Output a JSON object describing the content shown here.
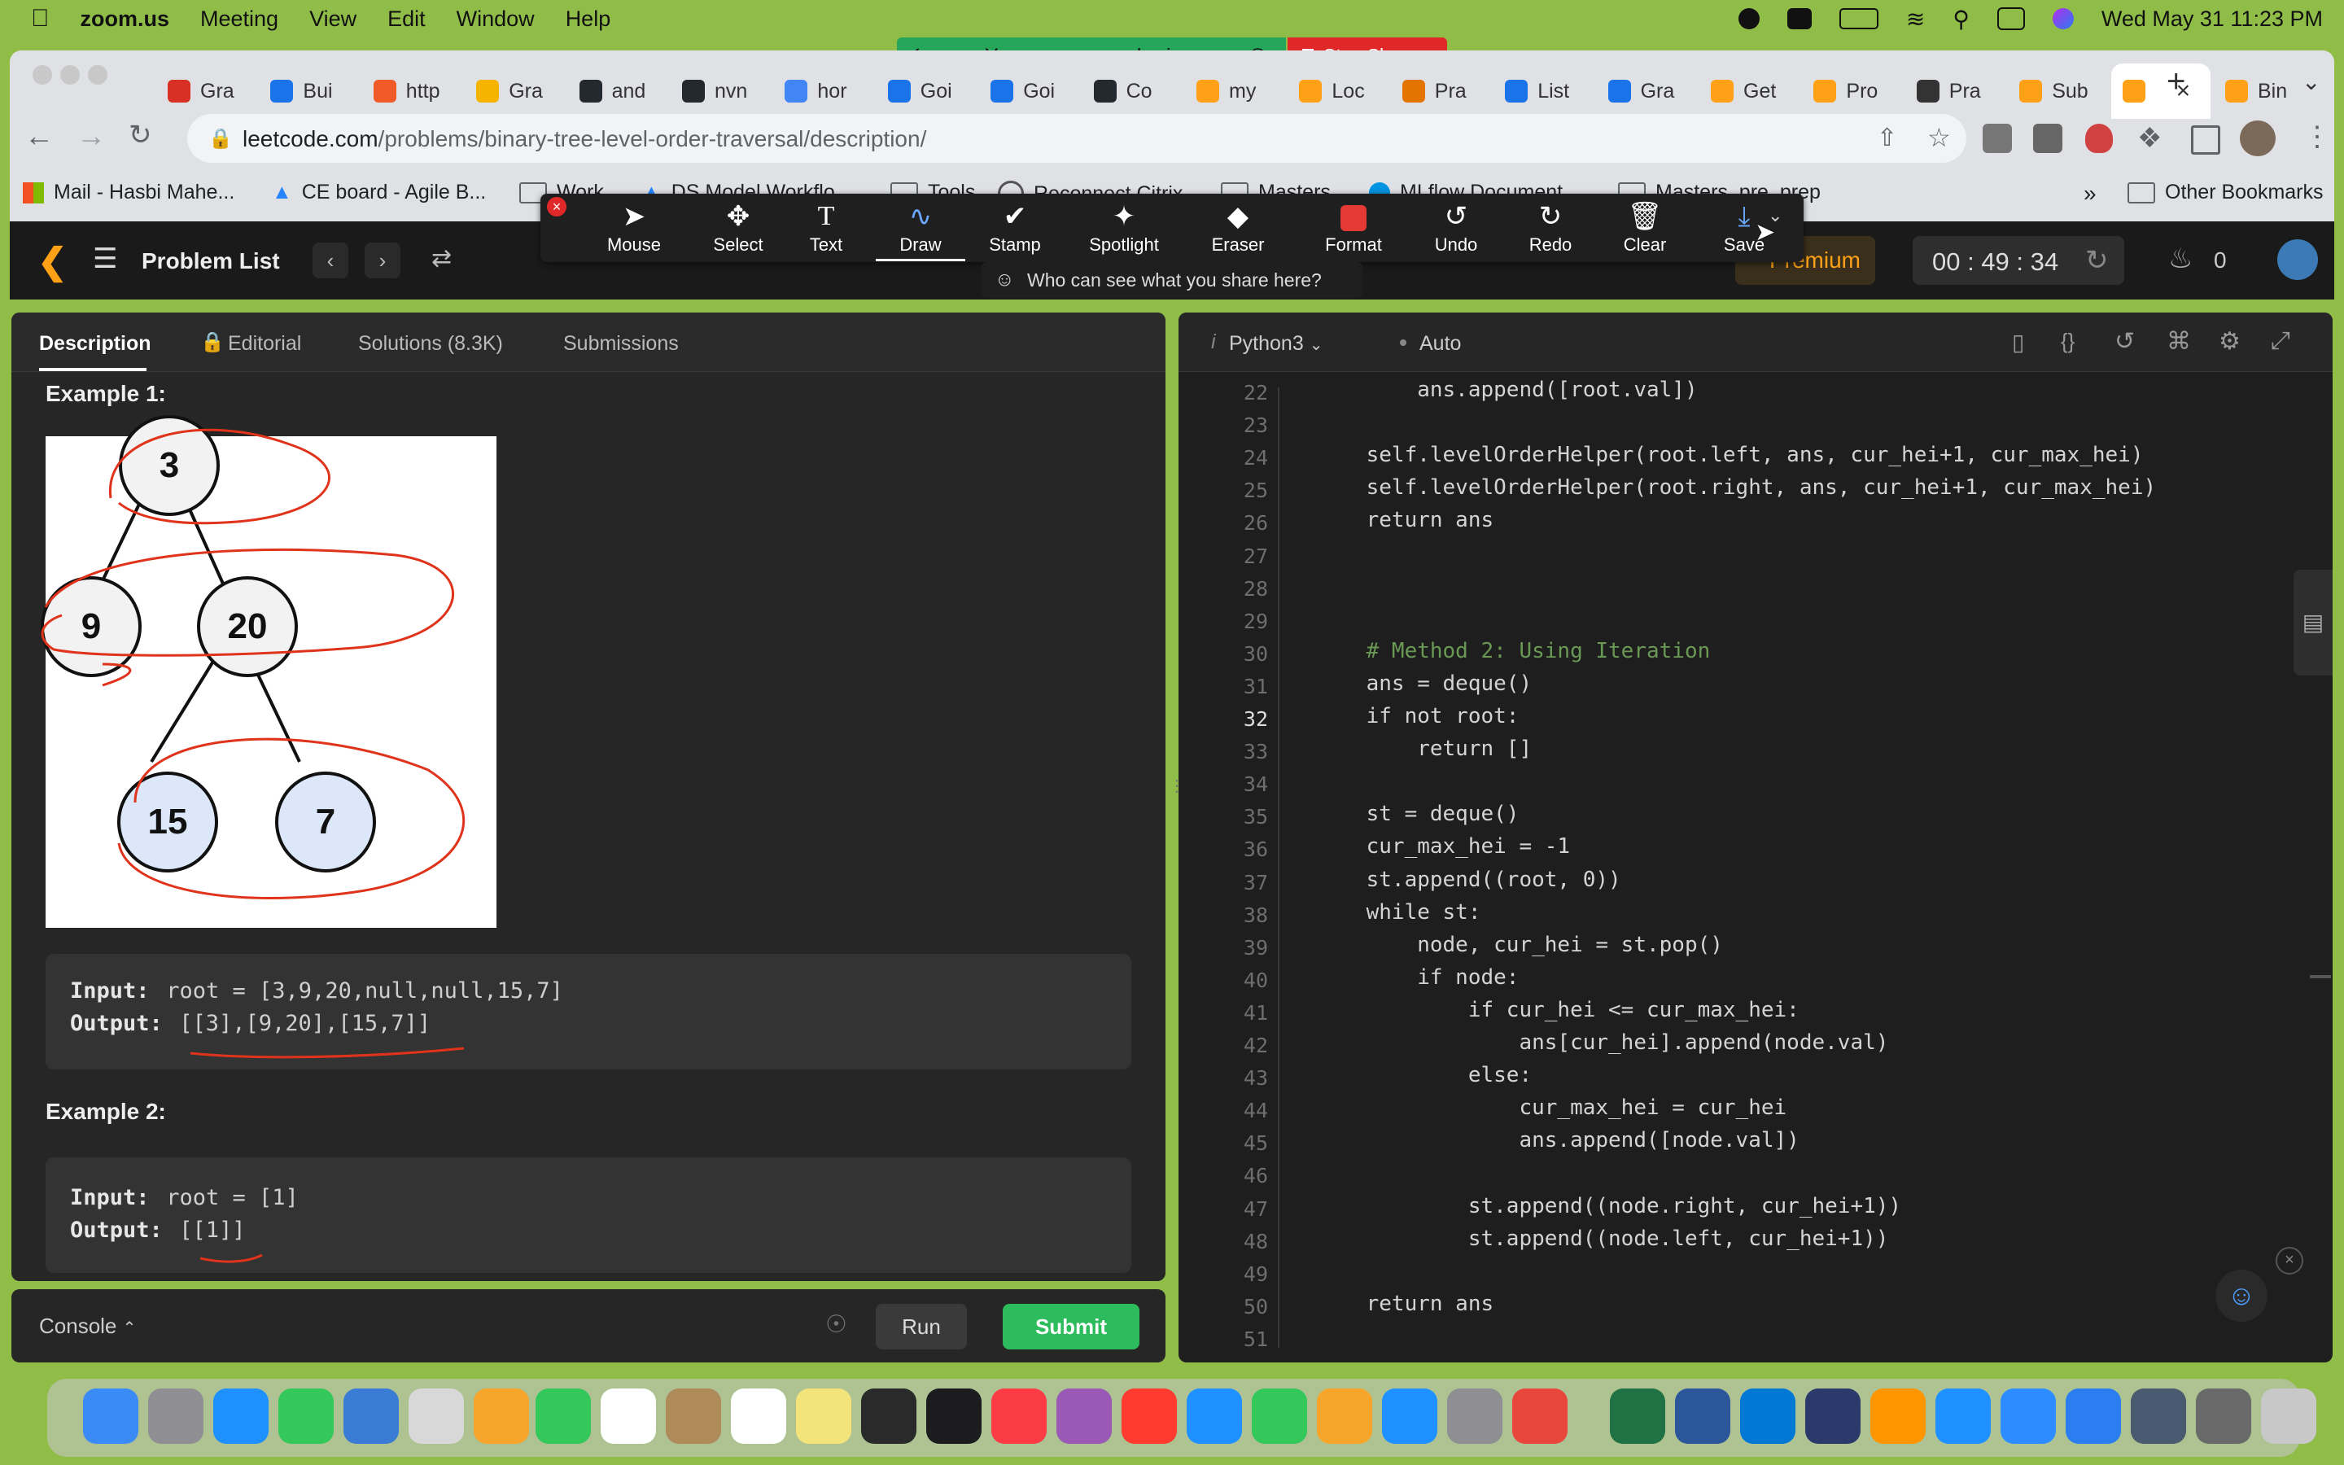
{
  "menubar": {
    "app": "zoom.us",
    "items": [
      "Meeting",
      "View",
      "Edit",
      "Window",
      "Help"
    ],
    "clock": "Wed May 31  11:23 PM"
  },
  "zoom": {
    "sharing_text": "You are screen sharing",
    "stop_share": "Stop Share",
    "tools": [
      "Mouse",
      "Select",
      "Text",
      "Draw",
      "Stamp",
      "Spotlight",
      "Eraser",
      "Format",
      "Undo",
      "Redo",
      "Clear",
      "Save"
    ],
    "who_can_see": "Who can see what you share here?"
  },
  "browser": {
    "tabs": [
      "Gra",
      "Bui",
      "http",
      "Gra",
      "and",
      "nvn",
      "hor",
      "Goi",
      "Goi",
      "Co",
      "my",
      "Loc",
      "Pra",
      "List",
      "Gra",
      "Get",
      "Pro",
      "Pra",
      "Sub",
      "",
      "Bin"
    ],
    "url_domain": "leetcode.com",
    "url_path": "/problems/binary-tree-level-order-traversal/description/",
    "bookmarks": [
      "Mail - Hasbi Mahe...",
      "CE board - Agile B...",
      "Work",
      "DS Model Workflo...",
      "Tools",
      "Reconnect Citrix",
      "Masters",
      "MLflow Document...",
      "Masters_pre_prep"
    ],
    "bookmarks_more": "»",
    "other_bookmarks": "Other Bookmarks"
  },
  "leetcode": {
    "problem_list": "Problem List",
    "premium": "Premium",
    "timer": "00 : 49 : 34",
    "streak": "0",
    "left_tabs": [
      "Description",
      "Editorial",
      "Solutions (8.3K)",
      "Submissions"
    ],
    "example1_title": "Example 1:",
    "tree_nodes": [
      "3",
      "9",
      "20",
      "15",
      "7"
    ],
    "example1_input_label": "Input:",
    "example1_input_value": " root = [3,9,20,null,null,15,7]",
    "example1_output_label": "Output:",
    "example1_output_value": " [[3],[9,20],[15,7]]",
    "example2_title": "Example 2:",
    "example2_input_label": "Input:",
    "example2_input_value": " root = [1]",
    "example2_output_label": "Output:",
    "example2_output_value": " [[1]]",
    "console": "Console",
    "run": "Run",
    "submit": "Submit",
    "language": "Python3",
    "auto": "Auto"
  },
  "code": [
    {
      "n": "22",
      "t": "        ans.append([root.val])"
    },
    {
      "n": "23",
      "t": ""
    },
    {
      "n": "24",
      "t": "    self.levelOrderHelper(root.left, ans, cur_hei+1, cur_max_hei)"
    },
    {
      "n": "25",
      "t": "    self.levelOrderHelper(root.right, ans, cur_hei+1, cur_max_hei)"
    },
    {
      "n": "26",
      "t": "    return ans"
    },
    {
      "n": "27",
      "t": ""
    },
    {
      "n": "28",
      "t": ""
    },
    {
      "n": "29",
      "t": ""
    },
    {
      "n": "30",
      "t": "    # Method 2: Using Iteration"
    },
    {
      "n": "31",
      "t": "    ans = deque()"
    },
    {
      "n": "32",
      "t": "    if not root:"
    },
    {
      "n": "33",
      "t": "        return []"
    },
    {
      "n": "34",
      "t": ""
    },
    {
      "n": "35",
      "t": "    st = deque()"
    },
    {
      "n": "36",
      "t": "    cur_max_hei = -1"
    },
    {
      "n": "37",
      "t": "    st.append((root, 0))"
    },
    {
      "n": "38",
      "t": "    while st:"
    },
    {
      "n": "39",
      "t": "        node, cur_hei = st.pop()"
    },
    {
      "n": "40",
      "t": "        if node:"
    },
    {
      "n": "41",
      "t": "            if cur_hei <= cur_max_hei:"
    },
    {
      "n": "42",
      "t": "                ans[cur_hei].append(node.val)"
    },
    {
      "n": "43",
      "t": "            else:"
    },
    {
      "n": "44",
      "t": "                cur_max_hei = cur_hei"
    },
    {
      "n": "45",
      "t": "                ans.append([node.val])"
    },
    {
      "n": "46",
      "t": ""
    },
    {
      "n": "47",
      "t": "            st.append((node.right, cur_hei+1))"
    },
    {
      "n": "48",
      "t": "            st.append((node.left, cur_hei+1))"
    },
    {
      "n": "49",
      "t": ""
    },
    {
      "n": "50",
      "t": "    return ans"
    },
    {
      "n": "51",
      "t": ""
    }
  ],
  "current_line": "32",
  "colors": {
    "accent_green": "#2cbb5d",
    "annotation_red": "#e0331b",
    "leetcode_orange": "#ffa116",
    "zoom_green": "#26a65b",
    "stop_red": "#e02828"
  }
}
